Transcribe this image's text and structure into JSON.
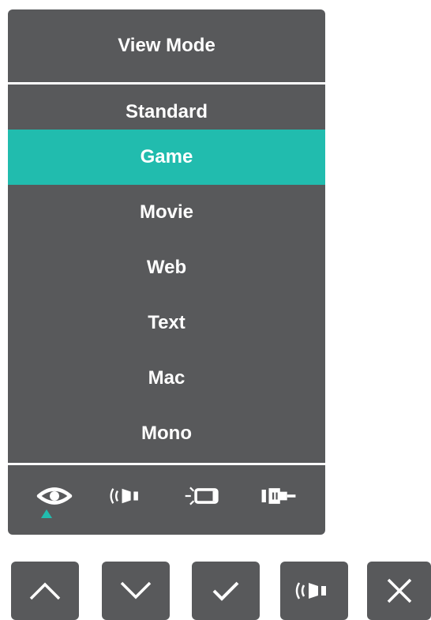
{
  "osd": {
    "title": "View Mode",
    "items": [
      {
        "label": "Standard",
        "selected": false
      },
      {
        "label": "Game",
        "selected": true
      },
      {
        "label": "Movie",
        "selected": false
      },
      {
        "label": "Web",
        "selected": false
      },
      {
        "label": "Text",
        "selected": false
      },
      {
        "label": "Mac",
        "selected": false
      },
      {
        "label": "Mono",
        "selected": false
      }
    ],
    "tabs": [
      "eye-icon",
      "speaker-icon",
      "light-screen-icon",
      "connector-icon"
    ],
    "active_tab": "eye-icon"
  },
  "buttons": [
    "up-icon",
    "down-icon",
    "check-icon",
    "speaker-icon",
    "close-icon"
  ],
  "colors": {
    "panel": "#58595b",
    "accent": "#21bcae",
    "text": "#ffffff"
  }
}
